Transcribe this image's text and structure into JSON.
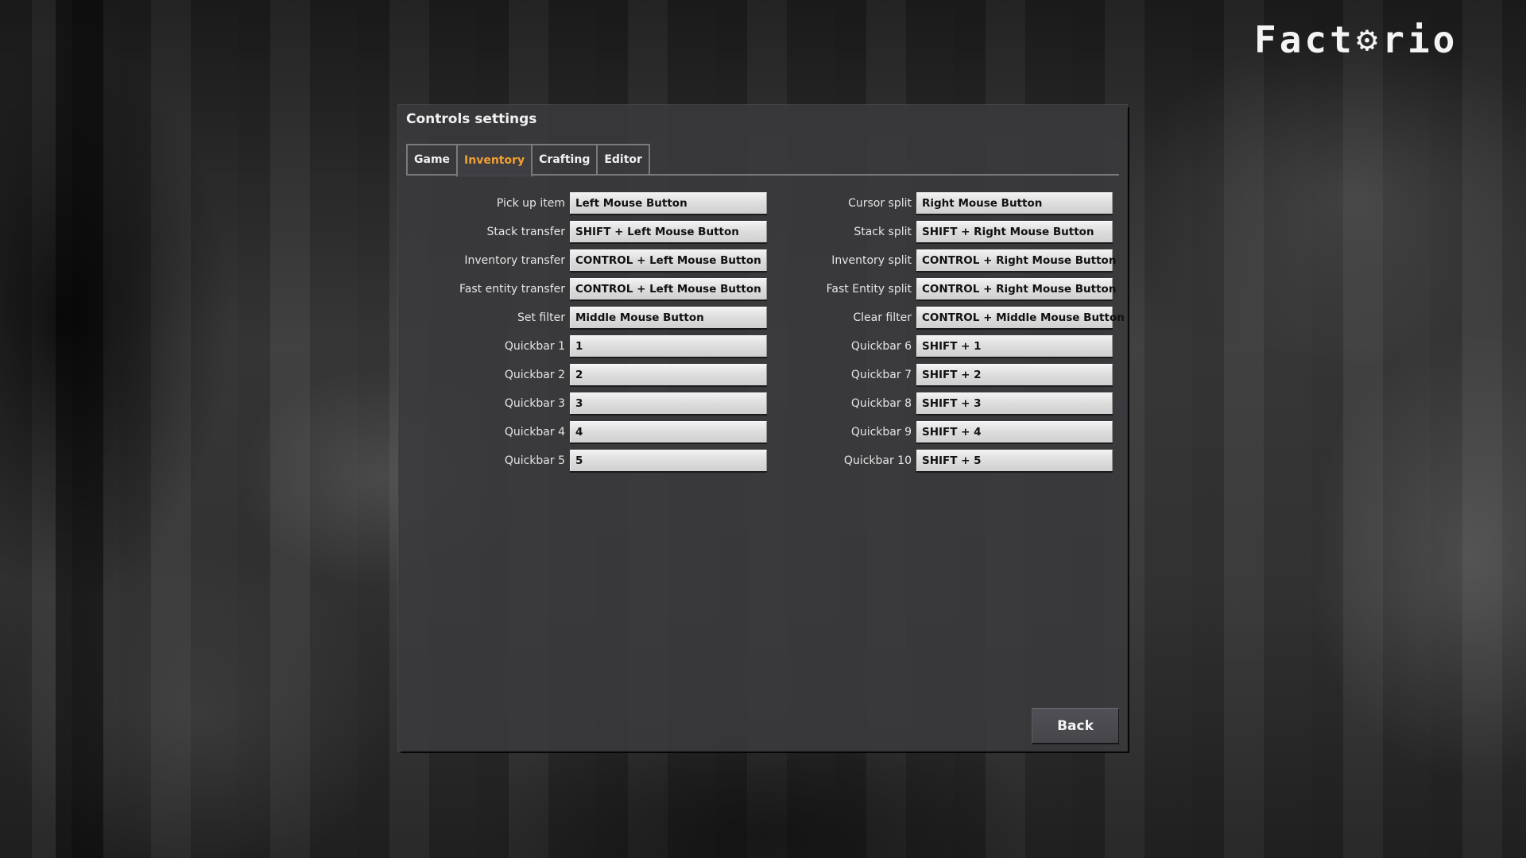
{
  "logo": {
    "text_a": "Fact",
    "gear": "⚙",
    "text_b": "rio",
    "alt": "Factorio"
  },
  "dialog": {
    "title": "Controls settings",
    "tabs": [
      {
        "label": "Game",
        "active": false
      },
      {
        "label": "Inventory",
        "active": true
      },
      {
        "label": "Crafting",
        "active": false
      },
      {
        "label": "Editor",
        "active": false
      }
    ],
    "accent_color": "#f0a033",
    "left_bindings": [
      {
        "label": "Pick up item",
        "key": "Left Mouse Button"
      },
      {
        "label": "Stack transfer",
        "key": "SHIFT + Left Mouse Button"
      },
      {
        "label": "Inventory transfer",
        "key": "CONTROL + Left Mouse Button"
      },
      {
        "label": "Fast entity transfer",
        "key": "CONTROL + Left Mouse Button"
      },
      {
        "label": "Set filter",
        "key": "Middle Mouse Button"
      },
      {
        "label": "Quickbar 1",
        "key": "1"
      },
      {
        "label": "Quickbar 2",
        "key": "2"
      },
      {
        "label": "Quickbar 3",
        "key": "3"
      },
      {
        "label": "Quickbar 4",
        "key": "4"
      },
      {
        "label": "Quickbar 5",
        "key": "5"
      }
    ],
    "right_bindings": [
      {
        "label": "Cursor split",
        "key": "Right Mouse Button"
      },
      {
        "label": "Stack split",
        "key": "SHIFT + Right Mouse Button"
      },
      {
        "label": "Inventory split",
        "key": "CONTROL + Right Mouse Button"
      },
      {
        "label": "Fast Entity split",
        "key": "CONTROL + Right Mouse Button"
      },
      {
        "label": "Clear filter",
        "key": "CONTROL + Middle Mouse Button"
      },
      {
        "label": "Quickbar 6",
        "key": "SHIFT + 1"
      },
      {
        "label": "Quickbar 7",
        "key": "SHIFT + 2"
      },
      {
        "label": "Quickbar 8",
        "key": "SHIFT + 3"
      },
      {
        "label": "Quickbar 9",
        "key": "SHIFT + 4"
      },
      {
        "label": "Quickbar 10",
        "key": "SHIFT + 5"
      }
    ],
    "back_label": "Back"
  }
}
